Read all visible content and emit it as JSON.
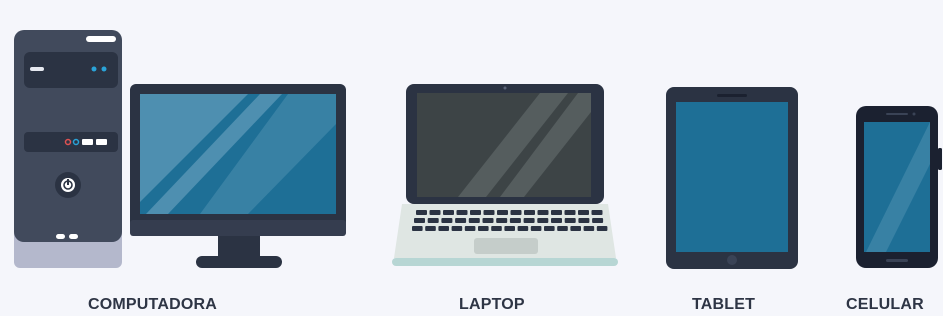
{
  "devices": [
    {
      "id": "computer",
      "label": "COMPUTADORA"
    },
    {
      "id": "laptop",
      "label": "LAPTOP"
    },
    {
      "id": "tablet",
      "label": "TABLET"
    },
    {
      "id": "phone",
      "label": "CELULAR"
    }
  ],
  "colors": {
    "background": "#f5f6fb",
    "device_dark": "#2b3343",
    "screen_blue": "#1e6f96",
    "screen_highlight": "#4e8fb0",
    "laptop_screen": "#3d4446",
    "laptop_base": "#dfe6e3",
    "tower_body": "#414a5c",
    "label_text": "#2e3545"
  }
}
